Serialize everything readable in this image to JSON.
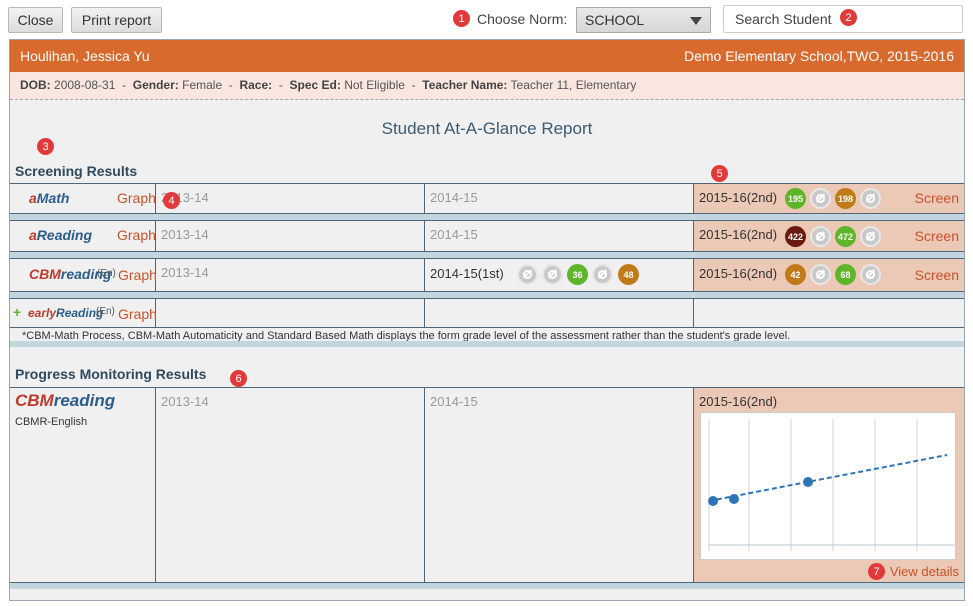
{
  "toolbar": {
    "close_label": "Close",
    "print_label": "Print report",
    "norm_label": "Choose Norm:",
    "norm_value": "SCHOOL",
    "search_placeholder": "Search Student"
  },
  "badges": [
    "1",
    "2",
    "3",
    "4",
    "5",
    "6",
    "7"
  ],
  "student": {
    "name": "Houlihan, Jessica Yu",
    "school": "Demo Elementary School,TWO, 2015-2016"
  },
  "info": {
    "dob_label": "DOB:",
    "dob": "2008-08-31",
    "gender_label": "Gender:",
    "gender": "Female",
    "race_label": "Race:",
    "race": "",
    "sped_label": "Spec Ed:",
    "sped": "Not Eligible",
    "teacher_label": "Teacher Name:",
    "teacher": "Teacher 11, Elementary",
    "sep": "-"
  },
  "report_title": "Student At-A-Glance Report",
  "screening": {
    "heading": "Screening Results",
    "graph_label": "Graph",
    "screen_label": "Screen",
    "rows": [
      {
        "logo": "aMath",
        "suffix": "",
        "y1": "2013-14",
        "y2": "2014-15",
        "y3": "2015-16(2nd)",
        "y2_scores": [],
        "y3_scores": [
          {
            "type": "score",
            "value": "195",
            "color": "#5fb52a"
          },
          {
            "type": "na"
          },
          {
            "type": "score",
            "value": "198",
            "color": "#c07a18"
          },
          {
            "type": "na"
          }
        ]
      },
      {
        "logo": "aReading",
        "suffix": "",
        "y1": "2013-14",
        "y2": "2014-15",
        "y3": "2015-16(2nd)",
        "y2_scores": [],
        "y3_scores": [
          {
            "type": "score",
            "value": "422",
            "color": "#6b1a10"
          },
          {
            "type": "na"
          },
          {
            "type": "score",
            "value": "472",
            "color": "#5fb52a"
          },
          {
            "type": "na"
          }
        ]
      },
      {
        "logo": "CBMreading",
        "suffix": "(En)",
        "y1": "2013-14",
        "y2": "2014-15(1st)",
        "y3": "2015-16(2nd)",
        "y2_scores": [
          {
            "type": "na"
          },
          {
            "type": "na"
          },
          {
            "type": "score",
            "value": "36",
            "color": "#5fb52a"
          },
          {
            "type": "na"
          },
          {
            "type": "score",
            "value": "48",
            "color": "#c07a18"
          }
        ],
        "y3_scores": [
          {
            "type": "score",
            "value": "42",
            "color": "#c07a18"
          },
          {
            "type": "na"
          },
          {
            "type": "score",
            "value": "68",
            "color": "#5fb52a"
          },
          {
            "type": "na"
          }
        ]
      },
      {
        "logo": "earlyReading",
        "suffix": "(En)"
      }
    ],
    "footnote": "*CBM-Math Process, CBM-Math Automaticity and Standard Based Math displays the form grade level of the assessment rather than the student's grade level."
  },
  "progress": {
    "heading": "Progress Monitoring Results",
    "logo": "CBMreading",
    "sub": "CBMR-English",
    "y1": "2013-14",
    "y2": "2014-15",
    "y3": "2015-16(2nd)",
    "view_details": "View details"
  },
  "colors": {
    "header": "#d96a2d",
    "link": "#c8532a",
    "score_green": "#5fb52a",
    "score_brown": "#c07a18",
    "score_maroon": "#6b1a10",
    "chart_blue": "#2e75b6"
  }
}
